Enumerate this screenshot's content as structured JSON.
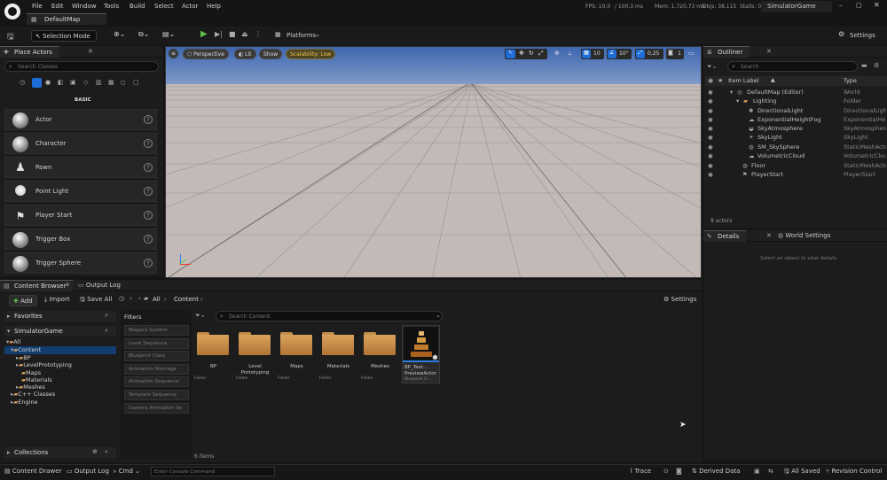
{
  "window": {
    "tab_title": "DefaultMap",
    "menu": [
      "File",
      "Edit",
      "Window",
      "Tools",
      "Build",
      "Select",
      "Actor",
      "Help"
    ],
    "stats": {
      "fps": "FPS: 10,0",
      "ms": "/ 100,3 ms",
      "mem": "Mem: 1.720,73 mb",
      "objs": "Objs: 38.115",
      "stalls": "Stalls: 0"
    },
    "project_name": "SimulatorGame"
  },
  "toolbar": {
    "selection_mode": "Selection Mode",
    "platforms": "Platforms",
    "settings": "Settings"
  },
  "place_actors": {
    "tab": "Place Actors",
    "search_placeholder": "Search Classes",
    "category": "BASIC",
    "items": [
      "Actor",
      "Character",
      "Pawn",
      "Point Light",
      "Player Start",
      "Trigger Box",
      "Trigger Sphere"
    ]
  },
  "viewport": {
    "perspective": "Perspective",
    "lit": "Lit",
    "show": "Show",
    "scalability": "Scalability: Low",
    "grid_snap": "10",
    "rot_snap": "10°",
    "scale_snap": "0,25",
    "cam_speed": "1"
  },
  "outliner": {
    "tab": "Outliner",
    "search_placeholder": "Search",
    "col_label": "Item Label",
    "col_type": "Type",
    "rows": [
      {
        "label": "DefaultMap (Editor)",
        "type": "World"
      },
      {
        "label": "Lighting",
        "type": "Folder"
      },
      {
        "label": "DirectionalLight",
        "type": "DirectionalLight"
      },
      {
        "label": "ExponentialHeightFog",
        "type": "ExponentialHeig"
      },
      {
        "label": "SkyAtmosphere",
        "type": "SkyAtmosphere"
      },
      {
        "label": "SkyLight",
        "type": "SkyLight"
      },
      {
        "label": "SM_SkySphere",
        "type": "StaticMeshActo"
      },
      {
        "label": "VolumetricCloud",
        "type": "VolumetricClou"
      },
      {
        "label": "Floor",
        "type": "StaticMeshActo"
      },
      {
        "label": "PlayerStart",
        "type": "PlayerStart"
      }
    ],
    "count": "8 actors"
  },
  "details": {
    "tab": "Details",
    "tab2": "World Settings",
    "empty": "Select an object to view details."
  },
  "content_browser": {
    "tab": "Content Browser",
    "tab2": "Output Log",
    "add": "Add",
    "import": "Import",
    "save_all": "Save All",
    "path": [
      "All",
      "Content"
    ],
    "settings": "Settings",
    "favorites": "Favorites",
    "project": "SimulatorGame",
    "tree": [
      "All",
      "Content",
      "BP",
      "LevelPrototyping",
      "Maps",
      "Materials",
      "Meshes",
      "C++ Classes",
      "Engine"
    ],
    "filters_title": "Filters",
    "filters": [
      "Niagara System",
      "Level Sequence",
      "Blueprint Class",
      "Animation Montage",
      "Animation Sequence",
      "Template Sequence",
      "Camera Animation Se"
    ],
    "search_placeholder": "Search Content",
    "assets": [
      {
        "name": "BP",
        "kind": "Folder"
      },
      {
        "name": "Level Prototyping",
        "kind": "Folder"
      },
      {
        "name": "Maps",
        "kind": "Folder"
      },
      {
        "name": "Materials",
        "kind": "Folder"
      },
      {
        "name": "Meshes",
        "kind": "Folder"
      },
      {
        "name": "BP_Text... PreviewActor",
        "kind": "Blueprint Cl..."
      }
    ],
    "item_count": "6 items",
    "collections": "Collections"
  },
  "statusbar": {
    "content_drawer": "Content Drawer",
    "output_log": "Output Log",
    "cmd": "Cmd",
    "console_placeholder": "Enter Console Command",
    "trace": "Trace",
    "derived_data": "Derived Data",
    "all_saved": "All Saved",
    "revision_control": "Revision Control"
  }
}
